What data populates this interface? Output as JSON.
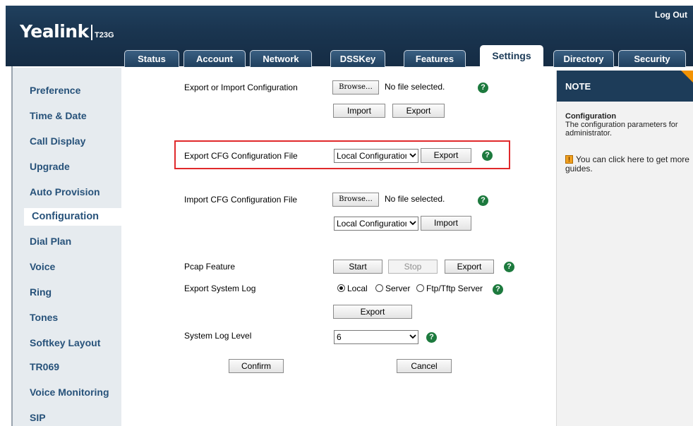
{
  "header": {
    "logo": "Yealink",
    "model": "T23G",
    "logout": "Log Out",
    "tabs": [
      {
        "label": "Status"
      },
      {
        "label": "Account"
      },
      {
        "label": "Network"
      },
      {
        "label": "DSSKey"
      },
      {
        "label": "Features"
      },
      {
        "label": "Settings",
        "active": true
      },
      {
        "label": "Directory"
      },
      {
        "label": "Security"
      }
    ]
  },
  "sidebar": {
    "items": [
      {
        "label": "Preference"
      },
      {
        "label": "Time & Date"
      },
      {
        "label": "Call Display"
      },
      {
        "label": "Upgrade"
      },
      {
        "label": "Auto Provision"
      },
      {
        "label": "Configuration",
        "active": true
      },
      {
        "label": "Dial Plan"
      },
      {
        "label": "Voice"
      },
      {
        "label": "Ring"
      },
      {
        "label": "Tones"
      },
      {
        "label": "Softkey Layout"
      },
      {
        "label": "TR069"
      },
      {
        "label": "Voice Monitoring"
      },
      {
        "label": "SIP"
      }
    ]
  },
  "content": {
    "export_import": {
      "label": "Export or Import Configuration",
      "browse": "Browse…",
      "file_status": "No file selected.",
      "import": "Import",
      "export": "Export"
    },
    "export_cfg": {
      "label": "Export CFG Configuration File",
      "select_value": "Local Configuration",
      "export": "Export"
    },
    "import_cfg": {
      "label": "Import CFG Configuration File",
      "browse": "Browse…",
      "file_status": "No file selected.",
      "select_value": "Local Configuration",
      "import": "Import"
    },
    "pcap": {
      "label": "Pcap Feature",
      "start": "Start",
      "stop": "Stop",
      "export": "Export"
    },
    "system_log": {
      "label": "Export System Log",
      "options": [
        "Local",
        "Server",
        "Ftp/Tftp Server"
      ],
      "selected": "Local",
      "export": "Export"
    },
    "log_level": {
      "label": "System Log Level",
      "value": "6"
    },
    "confirm": "Confirm",
    "cancel": "Cancel",
    "help_glyph": "?"
  },
  "note": {
    "title": "NOTE",
    "subtitle": "Configuration",
    "description": "The configuration parameters for administrator.",
    "guide": "You can click here to get more guides."
  },
  "colors": {
    "header_bg": "#1a3550",
    "highlight": "#e0292b",
    "help": "#1d7a3e",
    "note_corner": "#f39200"
  }
}
